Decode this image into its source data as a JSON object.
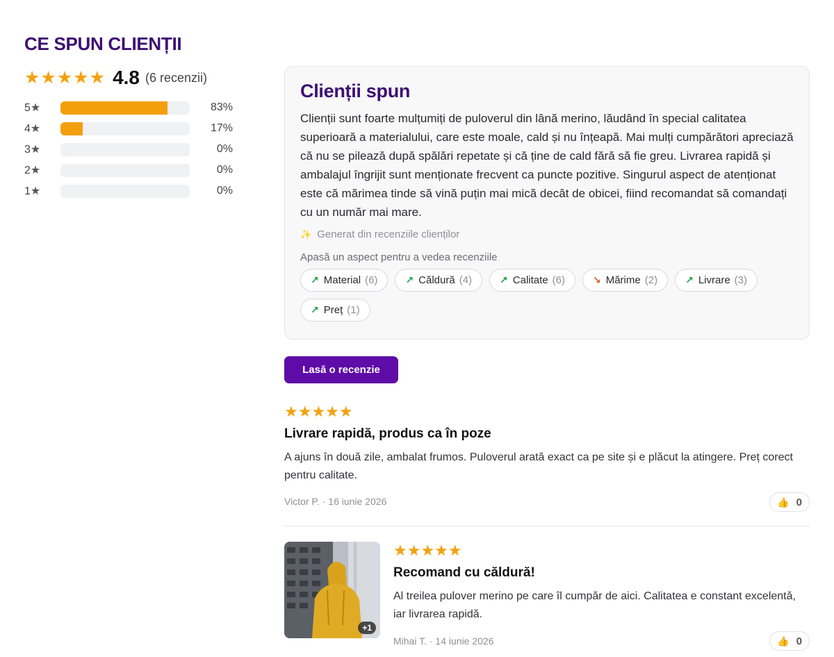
{
  "section_title": "CE SPUN CLIENȚII",
  "summary": {
    "stars": "★★★★★",
    "average": "4.8",
    "count": "(6 recenzii)",
    "distribution": [
      {
        "label": "5",
        "star": "★",
        "percent": 83,
        "percent_text": "83%"
      },
      {
        "label": "4",
        "star": "★",
        "percent": 17,
        "percent_text": "17%"
      },
      {
        "label": "3",
        "star": "★",
        "percent": 0,
        "percent_text": "0%"
      },
      {
        "label": "2",
        "star": "★",
        "percent": 0,
        "percent_text": "0%"
      },
      {
        "label": "1",
        "star": "★",
        "percent": 0,
        "percent_text": "0%"
      }
    ]
  },
  "ai_summary": {
    "title": "Clienții spun",
    "text": "Clienții sunt foarte mulțumiți de puloverul din lână merino, lăudând în special calitatea superioară a materialului, care este moale, cald și nu înțeapă. Mai mulți cumpărători apreciază că nu se pilează după spălări repetate și că ține de cald fără să fie greu. Livrarea rapidă și ambalajul îngrijit sunt menționate frecvent ca puncte pozitive. Singurul aspect de atenționat este că mărimea tinde să vină puțin mai mică decât de obicei, fiind recomandat să comandați cu un număr mai mare.",
    "generated_icon": "sparkles-icon",
    "generated_label": "Generat din recenziile clienților",
    "hint": "Apasă un aspect pentru a vedea recenziile",
    "aspects": [
      {
        "label": "Material",
        "count": "(6)",
        "trend": "up",
        "arrow": "↗"
      },
      {
        "label": "Căldură",
        "count": "(4)",
        "trend": "up",
        "arrow": "↗"
      },
      {
        "label": "Calitate",
        "count": "(6)",
        "trend": "up",
        "arrow": "↗"
      },
      {
        "label": "Mărime",
        "count": "(2)",
        "trend": "down",
        "arrow": "↘"
      },
      {
        "label": "Livrare",
        "count": "(3)",
        "trend": "up",
        "arrow": "↗"
      },
      {
        "label": "Preț",
        "count": "(1)",
        "trend": "up",
        "arrow": "↗"
      }
    ]
  },
  "write_review_label": "Lasă o recenzie",
  "reviews": [
    {
      "stars": "★★★★★",
      "title": "Livrare rapidă, produs ca în poze",
      "body": "A ajuns în două zile, ambalat frumos. Puloverul arată exact ca pe site și e plăcut la atingere. Preț corect pentru calitate.",
      "meta": "Victor P. · 16 iunie 2026",
      "helpful_icon": "thumbs-up-icon",
      "helpful_count": "0"
    },
    {
      "stars": "★★★★★",
      "title": "Recomand cu căldură!",
      "body": "Al treilea pulover merino pe care îl cumpăr de aici. Calitatea e constant excelentă, iar livrarea rapidă.",
      "meta": "Mihai T. · 14 iunie 2026",
      "helpful_icon": "thumbs-up-icon",
      "helpful_count": "0",
      "photo_extra": "+1"
    }
  ],
  "colors": {
    "brand": "#3d0f73",
    "button": "#5f0ba8",
    "star": "#f2a20f",
    "trend_up": "#17a34a",
    "trend_down": "#e0561c"
  }
}
